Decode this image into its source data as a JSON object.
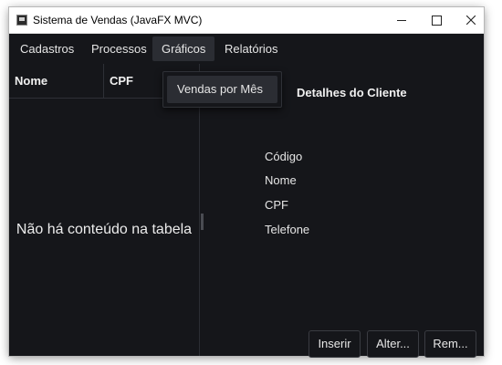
{
  "window": {
    "title": "Sistema de Vendas (JavaFX MVC)",
    "controls": {
      "minimize_icon": "minimize-icon",
      "maximize_icon": "maximize-icon",
      "close_icon": "close-icon"
    }
  },
  "menubar": {
    "items": [
      {
        "label": "Cadastros"
      },
      {
        "label": "Processos"
      },
      {
        "label": "Gráficos",
        "active": true
      },
      {
        "label": "Relatórios"
      }
    ],
    "open_menu": {
      "items": [
        {
          "label": "Vendas por Mês"
        }
      ]
    }
  },
  "table": {
    "columns": [
      "Nome",
      "CPF"
    ],
    "empty_message": "Não há conteúdo na tabela"
  },
  "details": {
    "title": "Detalhes do Cliente",
    "fields": [
      "Código",
      "Nome",
      "CPF",
      "Telefone"
    ],
    "buttons": {
      "insert": "Inserir",
      "edit": "Alter...",
      "remove": "Rem..."
    }
  },
  "colors": {
    "background": "#15161a",
    "highlight": "#2b2d33",
    "text": "#e6e6e6"
  }
}
